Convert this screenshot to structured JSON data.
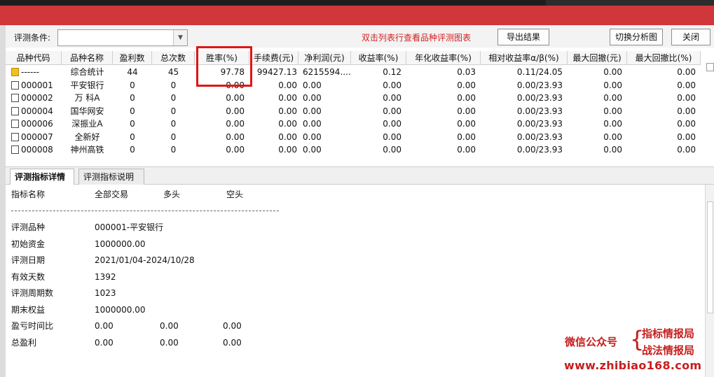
{
  "toolbar": {
    "condition_label": "评测条件:",
    "condition_value": "",
    "hint": "双击列表行查看品种评测图表",
    "export_label": "导出结果",
    "switch_label": "切换分析图",
    "close_label": "关闭"
  },
  "grid": {
    "headers": [
      "品种代码",
      "品种名称",
      "盈利数",
      "总次数",
      "胜率(%)",
      "手续费(元)",
      "净利润(元)",
      "收益率(%)",
      "年化收益率(%)",
      "相对收益率α/β(%)",
      "最大回撤(元)",
      "最大回撤比(%)"
    ],
    "rows": [
      {
        "icon": "summary-icon",
        "code": "------",
        "name": "综合统计",
        "win": "44",
        "total": "45",
        "rate": "97.78",
        "fee": "99427.13",
        "net": "6215594....",
        "ret": "0.12",
        "ann": "0.03",
        "rel": "0.11/24.05",
        "dd": "0.00",
        "ddr": "0.00"
      },
      {
        "icon": "file-icon",
        "code": "000001",
        "name": "平安银行",
        "win": "0",
        "total": "0",
        "rate": "0.00",
        "fee": "0.00",
        "net": "0.00",
        "ret": "0.00",
        "ann": "0.00",
        "rel": "0.00/23.93",
        "dd": "0.00",
        "ddr": "0.00"
      },
      {
        "icon": "file-icon",
        "code": "000002",
        "name": "万 科A",
        "win": "0",
        "total": "0",
        "rate": "0.00",
        "fee": "0.00",
        "net": "0.00",
        "ret": "0.00",
        "ann": "0.00",
        "rel": "0.00/23.93",
        "dd": "0.00",
        "ddr": "0.00"
      },
      {
        "icon": "file-icon",
        "code": "000004",
        "name": "国华网安",
        "win": "0",
        "total": "0",
        "rate": "0.00",
        "fee": "0.00",
        "net": "0.00",
        "ret": "0.00",
        "ann": "0.00",
        "rel": "0.00/23.93",
        "dd": "0.00",
        "ddr": "0.00"
      },
      {
        "icon": "file-icon",
        "code": "000006",
        "name": "深振业A",
        "win": "0",
        "total": "0",
        "rate": "0.00",
        "fee": "0.00",
        "net": "0.00",
        "ret": "0.00",
        "ann": "0.00",
        "rel": "0.00/23.93",
        "dd": "0.00",
        "ddr": "0.00"
      },
      {
        "icon": "file-icon",
        "code": "000007",
        "name": "全新好",
        "win": "0",
        "total": "0",
        "rate": "0.00",
        "fee": "0.00",
        "net": "0.00",
        "ret": "0.00",
        "ann": "0.00",
        "rel": "0.00/23.93",
        "dd": "0.00",
        "ddr": "0.00"
      },
      {
        "icon": "file-icon",
        "code": "000008",
        "name": "神州高铁",
        "win": "0",
        "total": "0",
        "rate": "0.00",
        "fee": "0.00",
        "net": "0.00",
        "ret": "0.00",
        "ann": "0.00",
        "rel": "0.00/23.93",
        "dd": "0.00",
        "ddr": "0.00"
      }
    ]
  },
  "tabs": {
    "detail": "评测指标详情",
    "explain": "评测指标说明"
  },
  "detail": {
    "header": [
      "指标名称",
      "全部交易",
      "多头",
      "空头"
    ],
    "rows": [
      {
        "label": "评测品种",
        "v1": "000001-平安银行",
        "v2": "",
        "v3": ""
      },
      {
        "label": "初始资金",
        "v1": "1000000.00",
        "v2": "",
        "v3": ""
      },
      {
        "label": "评测日期",
        "v1": "2021/01/04-2024/10/28",
        "v2": "",
        "v3": ""
      },
      {
        "label": "有效天数",
        "v1": "1392",
        "v2": "",
        "v3": ""
      },
      {
        "label": "评测周期数",
        "v1": "1023",
        "v2": "",
        "v3": ""
      },
      {
        "label": "期末权益",
        "v1": "1000000.00",
        "v2": "",
        "v3": ""
      },
      {
        "label": "盈亏时间比",
        "v1": "0.00",
        "v2": "0.00",
        "v3": "0.00"
      },
      {
        "label": "总盈利",
        "v1": "0.00",
        "v2": "0.00",
        "v3": "0.00"
      }
    ]
  },
  "watermark": {
    "label": "微信公众号",
    "brace": "{",
    "name1": "指标情报局",
    "name2": "战法情报局",
    "url": "www.zhibiao168.com"
  },
  "colors": {
    "title_bar": "#d1363b",
    "hint_text": "#d32020",
    "highlight_box": "#e01515",
    "watermark": "#c61e1e"
  }
}
